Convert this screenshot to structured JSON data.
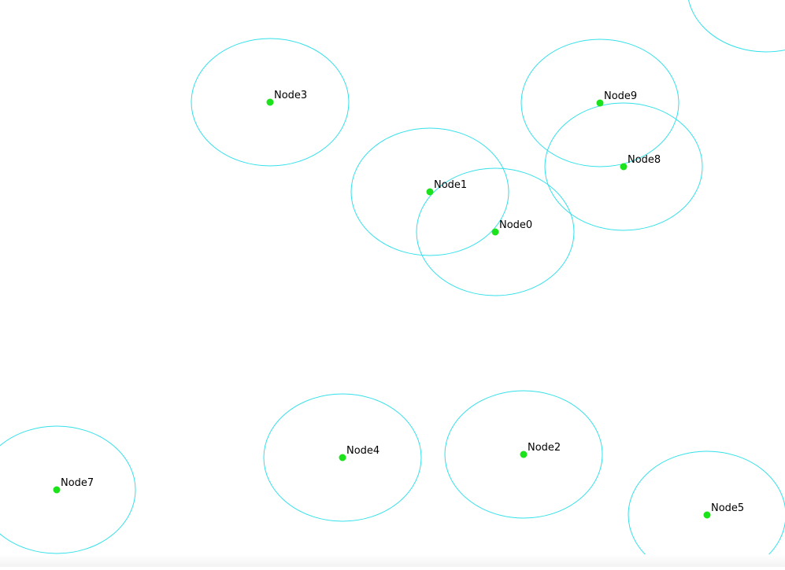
{
  "colors": {
    "background": "#ffffff",
    "range_ring": "#33e0ea",
    "node": "#1be21b",
    "label": "#000000"
  },
  "nodes": [
    {
      "id": "node-0",
      "label": "Node0"
    },
    {
      "id": "node-1",
      "label": "Node1"
    },
    {
      "id": "node-2",
      "label": "Node2"
    },
    {
      "id": "node-3",
      "label": "Node3"
    },
    {
      "id": "node-4",
      "label": "Node4"
    },
    {
      "id": "node-5",
      "label": "Node5"
    },
    {
      "id": "node-7",
      "label": "Node7"
    },
    {
      "id": "node-8",
      "label": "Node8"
    },
    {
      "id": "node-9",
      "label": "Node9"
    }
  ]
}
